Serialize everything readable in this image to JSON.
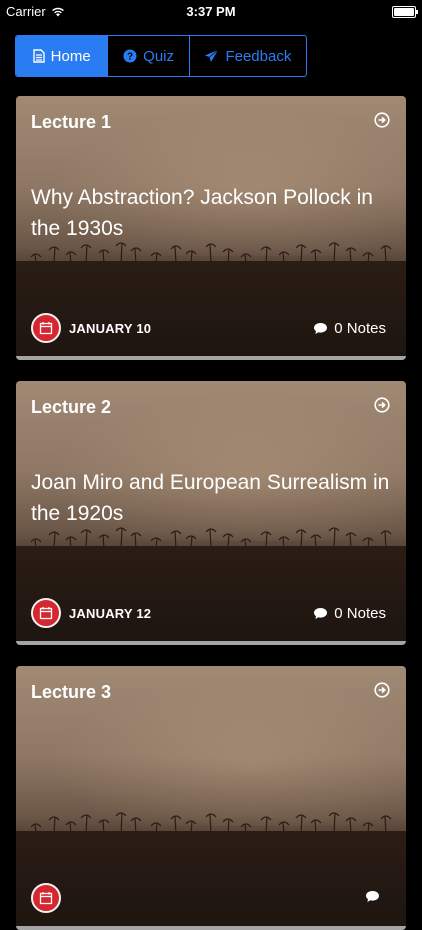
{
  "status_bar": {
    "carrier": "Carrier",
    "time": "3:37 PM"
  },
  "nav": {
    "items": [
      {
        "label": "Home",
        "icon": "document-icon",
        "active": true
      },
      {
        "label": "Quiz",
        "icon": "question-circle-icon",
        "active": false
      },
      {
        "label": "Feedback",
        "icon": "paper-plane-icon",
        "active": false
      }
    ]
  },
  "colors": {
    "accent": "#2a7cf2",
    "calendar_badge": "#d6262f"
  },
  "lectures": [
    {
      "label": "Lecture 1",
      "title": "Why Abstraction? Jackson Pollock in the 1930s",
      "date": "JANUARY 10",
      "notes": "0 Notes"
    },
    {
      "label": "Lecture 2",
      "title": "Joan Miro and European Surrealism in the 1920s",
      "date": "JANUARY 12",
      "notes": "0 Notes"
    },
    {
      "label": "Lecture 3",
      "title": "",
      "date": "",
      "notes": ""
    }
  ]
}
